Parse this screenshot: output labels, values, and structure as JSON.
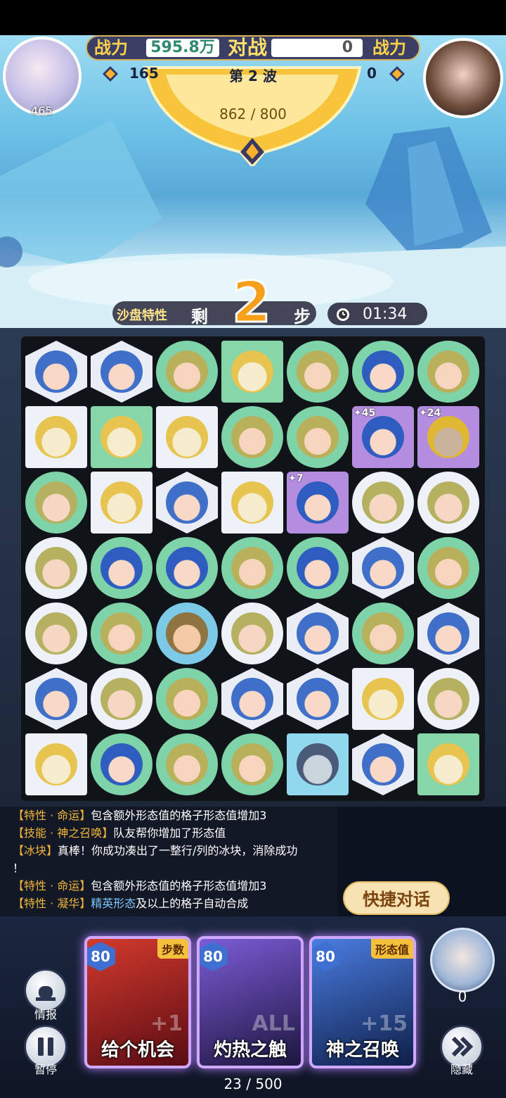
{
  "header": {
    "power_label_left": "战力",
    "my_power": "595.8万",
    "vs_label": "对战",
    "enemy_power": "0",
    "power_label_right": "战力",
    "my_stars": "165",
    "wave": "第 2 波",
    "enemy_stars": "0",
    "my_level": "465",
    "hp": "862 / 800"
  },
  "steps": {
    "sandplate_label": "沙盘特性",
    "remain_label": "剩",
    "count": "2",
    "unit": "步",
    "timer": "01:34"
  },
  "board": {
    "rows": 7,
    "cols": 7,
    "cells": [
      [
        {
          "tile": "hex",
          "face": "blue"
        },
        {
          "tile": "hex",
          "face": "blue"
        },
        {
          "tile": "circle-green",
          "face": "orc"
        },
        {
          "tile": "green",
          "face": "pudding"
        },
        {
          "tile": "circle-green",
          "face": "orc"
        },
        {
          "tile": "circle-green",
          "face": "goggle"
        },
        {
          "tile": "circle-green",
          "face": "orc"
        }
      ],
      [
        {
          "tile": "white",
          "face": "pudding"
        },
        {
          "tile": "green",
          "face": "pudding"
        },
        {
          "tile": "white",
          "face": "pudding"
        },
        {
          "tile": "circle-green",
          "face": "orc"
        },
        {
          "tile": "circle-green",
          "face": "orc"
        },
        {
          "tile": "purple",
          "face": "goggle",
          "badge": "45"
        },
        {
          "tile": "purple",
          "face": "owl",
          "badge": "24"
        }
      ],
      [
        {
          "tile": "circle-green",
          "face": "elf"
        },
        {
          "tile": "white",
          "face": "pudding"
        },
        {
          "tile": "hex",
          "face": "blue"
        },
        {
          "tile": "white",
          "face": "pudding"
        },
        {
          "tile": "purple",
          "face": "goggle",
          "badge": "7"
        },
        {
          "tile": "circle-white",
          "face": "elf"
        },
        {
          "tile": "circle-white",
          "face": "elf"
        }
      ],
      [
        {
          "tile": "circle-white",
          "face": "elf"
        },
        {
          "tile": "circle-green",
          "face": "goggle"
        },
        {
          "tile": "circle-green",
          "face": "goggle"
        },
        {
          "tile": "circle-green",
          "face": "orc"
        },
        {
          "tile": "circle-green",
          "face": "goggle"
        },
        {
          "tile": "hex",
          "face": "blue"
        },
        {
          "tile": "circle-green",
          "face": "orc"
        }
      ],
      [
        {
          "tile": "circle-white",
          "face": "elf"
        },
        {
          "tile": "circle-green",
          "face": "orc"
        },
        {
          "tile": "circle-cyan",
          "face": "bear"
        },
        {
          "tile": "circle-white",
          "face": "elf"
        },
        {
          "tile": "hex",
          "face": "blue"
        },
        {
          "tile": "circle-green",
          "face": "orc"
        },
        {
          "tile": "hex",
          "face": "blue"
        }
      ],
      [
        {
          "tile": "hex",
          "face": "blue"
        },
        {
          "tile": "circle-white",
          "face": "elf"
        },
        {
          "tile": "circle-green",
          "face": "orc"
        },
        {
          "tile": "hex",
          "face": "blue"
        },
        {
          "tile": "hex",
          "face": "blue"
        },
        {
          "tile": "white",
          "face": "pudding"
        },
        {
          "tile": "circle-white",
          "face": "elf"
        }
      ],
      [
        {
          "tile": "white",
          "face": "pudding"
        },
        {
          "tile": "circle-green",
          "face": "goggle"
        },
        {
          "tile": "circle-green",
          "face": "orc"
        },
        {
          "tile": "circle-green",
          "face": "orc"
        },
        {
          "tile": "cyan",
          "face": "shark"
        },
        {
          "tile": "hex",
          "face": "blue"
        },
        {
          "tile": "green",
          "face": "pudding"
        }
      ]
    ]
  },
  "log": {
    "lines": [
      {
        "tag": "【特性 · 命运】",
        "text": "包含额外形态值的格子形态值增加3"
      },
      {
        "tag": "【技能 · 神之召唤】",
        "text": "队友帮你增加了形态值"
      },
      {
        "tag": "【冰块】",
        "text": "真棒！你成功凑出了一整行/列的冰块，消除成功"
      },
      {
        "tag": "",
        "text": "！"
      },
      {
        "tag": "【特性 · 命运】",
        "text": "包含额外形态值的格子形态值增加3"
      },
      {
        "tag": "【特性 · 凝华】",
        "text": "及以上的格子自动合成",
        "highlight": "精英形态"
      }
    ]
  },
  "quick_chat": "快捷对话",
  "buttons": {
    "info": "情报",
    "pause": "暂停",
    "hide": "隐藏"
  },
  "cards": [
    {
      "cost": "80",
      "tag": "步数",
      "name": "给个机会",
      "big": "+1",
      "color": "#8b1820"
    },
    {
      "cost": "80",
      "tag": "",
      "name": "灼热之触",
      "big": "ALL",
      "color": "#3a2a72"
    },
    {
      "cost": "80",
      "tag": "形态值",
      "name": "神之召唤",
      "big": "+15",
      "color": "#1d3d84"
    }
  ],
  "ally_count": "0",
  "progress": "23 / 500",
  "colors": {
    "gold": "#ffd24a",
    "orange": "#f59f1a",
    "card_glow": "#b57cff"
  }
}
